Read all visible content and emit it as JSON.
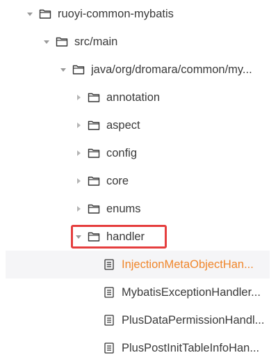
{
  "tree": {
    "nodes": [
      {
        "label": "ruoyi-common-mybatis",
        "type": "folder",
        "expanded": true,
        "icon": "folder-icon"
      },
      {
        "label": "src/main",
        "type": "folder",
        "expanded": true,
        "icon": "folder-icon"
      },
      {
        "label": "java/org/dromara/common/my...",
        "type": "folder",
        "expanded": true,
        "icon": "folder-icon"
      },
      {
        "label": "annotation",
        "type": "folder",
        "expanded": false,
        "icon": "folder-icon"
      },
      {
        "label": "aspect",
        "type": "folder",
        "expanded": false,
        "icon": "folder-icon"
      },
      {
        "label": "config",
        "type": "folder",
        "expanded": false,
        "icon": "folder-icon"
      },
      {
        "label": "core",
        "type": "folder",
        "expanded": false,
        "icon": "folder-icon"
      },
      {
        "label": "enums",
        "type": "folder",
        "expanded": false,
        "icon": "folder-icon"
      },
      {
        "label": "handler",
        "type": "folder",
        "expanded": true,
        "icon": "folder-icon",
        "highlighted": true
      },
      {
        "label": "InjectionMetaObjectHan...",
        "type": "file",
        "icon": "file-icon",
        "selected": true
      },
      {
        "label": "MybatisExceptionHandler...",
        "type": "file",
        "icon": "file-icon"
      },
      {
        "label": "PlusDataPermissionHandl...",
        "type": "file",
        "icon": "file-icon"
      },
      {
        "label": "PlusPostInitTableInfoHan...",
        "type": "file",
        "icon": "file-icon"
      }
    ]
  },
  "colors": {
    "selected_text": "#f0862b",
    "selected_bg": "#f5f5f7",
    "highlight_border": "#e53e3e",
    "text": "#3a3a3a",
    "arrow": "#b5b5b5"
  }
}
